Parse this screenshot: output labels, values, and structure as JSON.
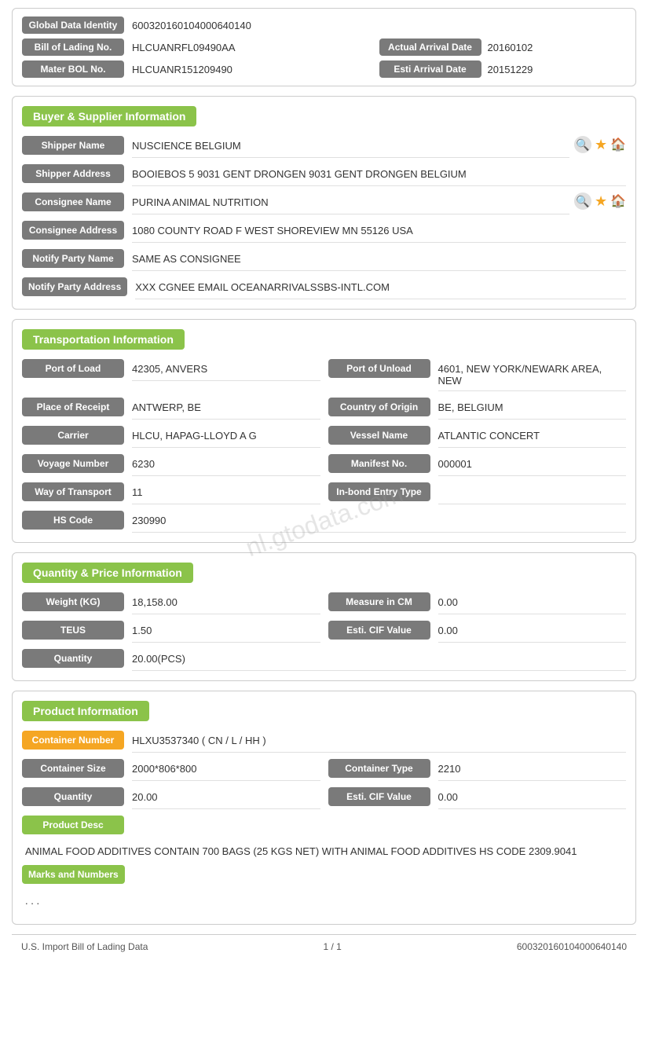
{
  "header": {
    "global_data_identity_label": "Global Data Identity",
    "global_data_identity_value": "600320160104000640140",
    "bill_of_lading_label": "Bill of Lading No.",
    "bill_of_lading_value": "HLCUANRFL09490AA",
    "actual_arrival_date_label": "Actual Arrival Date",
    "actual_arrival_date_value": "20160102",
    "mater_bol_label": "Mater BOL No.",
    "mater_bol_value": "HLCUANR151209490",
    "esti_arrival_label": "Esti Arrival Date",
    "esti_arrival_value": "20151229"
  },
  "buyer_supplier": {
    "section_title": "Buyer & Supplier Information",
    "shipper_name_label": "Shipper Name",
    "shipper_name_value": "NUSCIENCE BELGIUM",
    "shipper_address_label": "Shipper Address",
    "shipper_address_value": "BOOIEBOS 5 9031 GENT DRONGEN 9031 GENT DRONGEN BELGIUM",
    "consignee_name_label": "Consignee Name",
    "consignee_name_value": "PURINA ANIMAL NUTRITION",
    "consignee_address_label": "Consignee Address",
    "consignee_address_value": "1080 COUNTY ROAD F WEST SHOREVIEW MN 55126 USA",
    "notify_party_name_label": "Notify Party Name",
    "notify_party_name_value": "SAME AS CONSIGNEE",
    "notify_party_address_label": "Notify Party Address",
    "notify_party_address_value": "XXX CGNEE EMAIL OCEANARRIVALSSBS-INTL.COM"
  },
  "transportation": {
    "section_title": "Transportation Information",
    "port_of_load_label": "Port of Load",
    "port_of_load_value": "42305, ANVERS",
    "port_of_unload_label": "Port of Unload",
    "port_of_unload_value": "4601, NEW YORK/NEWARK AREA, NEW",
    "place_of_receipt_label": "Place of Receipt",
    "place_of_receipt_value": "ANTWERP, BE",
    "country_of_origin_label": "Country of Origin",
    "country_of_origin_value": "BE, BELGIUM",
    "carrier_label": "Carrier",
    "carrier_value": "HLCU, HAPAG-LLOYD A G",
    "vessel_name_label": "Vessel Name",
    "vessel_name_value": "ATLANTIC CONCERT",
    "voyage_number_label": "Voyage Number",
    "voyage_number_value": "6230",
    "manifest_no_label": "Manifest No.",
    "manifest_no_value": "000001",
    "way_of_transport_label": "Way of Transport",
    "way_of_transport_value": "11",
    "in_bond_entry_label": "In-bond Entry Type",
    "in_bond_entry_value": "",
    "hs_code_label": "HS Code",
    "hs_code_value": "230990"
  },
  "quantity_price": {
    "section_title": "Quantity & Price Information",
    "weight_label": "Weight (KG)",
    "weight_value": "18,158.00",
    "measure_in_cm_label": "Measure in CM",
    "measure_in_cm_value": "0.00",
    "teus_label": "TEUS",
    "teus_value": "1.50",
    "esti_cif_label": "Esti. CIF Value",
    "esti_cif_value": "0.00",
    "quantity_label": "Quantity",
    "quantity_value": "20.00(PCS)"
  },
  "product_info": {
    "section_title": "Product Information",
    "container_number_label": "Container Number",
    "container_number_value": "HLXU3537340 ( CN / L / HH )",
    "container_size_label": "Container Size",
    "container_size_value": "2000*806*800",
    "container_type_label": "Container Type",
    "container_type_value": "2210",
    "quantity_label": "Quantity",
    "quantity_value": "20.00",
    "esti_cif_label": "Esti. CIF Value",
    "esti_cif_value": "0.00",
    "product_desc_label": "Product Desc",
    "product_desc_value": "ANIMAL FOOD ADDITIVES CONTAIN 700 BAGS (25 KGS NET) WITH ANIMAL FOOD ADDITIVES HS CODE 2309.9041",
    "marks_and_numbers_label": "Marks and Numbers",
    "marks_and_numbers_value": ". . ."
  },
  "footer": {
    "left": "U.S. Import Bill of Lading Data",
    "center": "1 / 1",
    "right": "600320160104000640140"
  },
  "watermark": "nl.gtodata.com"
}
